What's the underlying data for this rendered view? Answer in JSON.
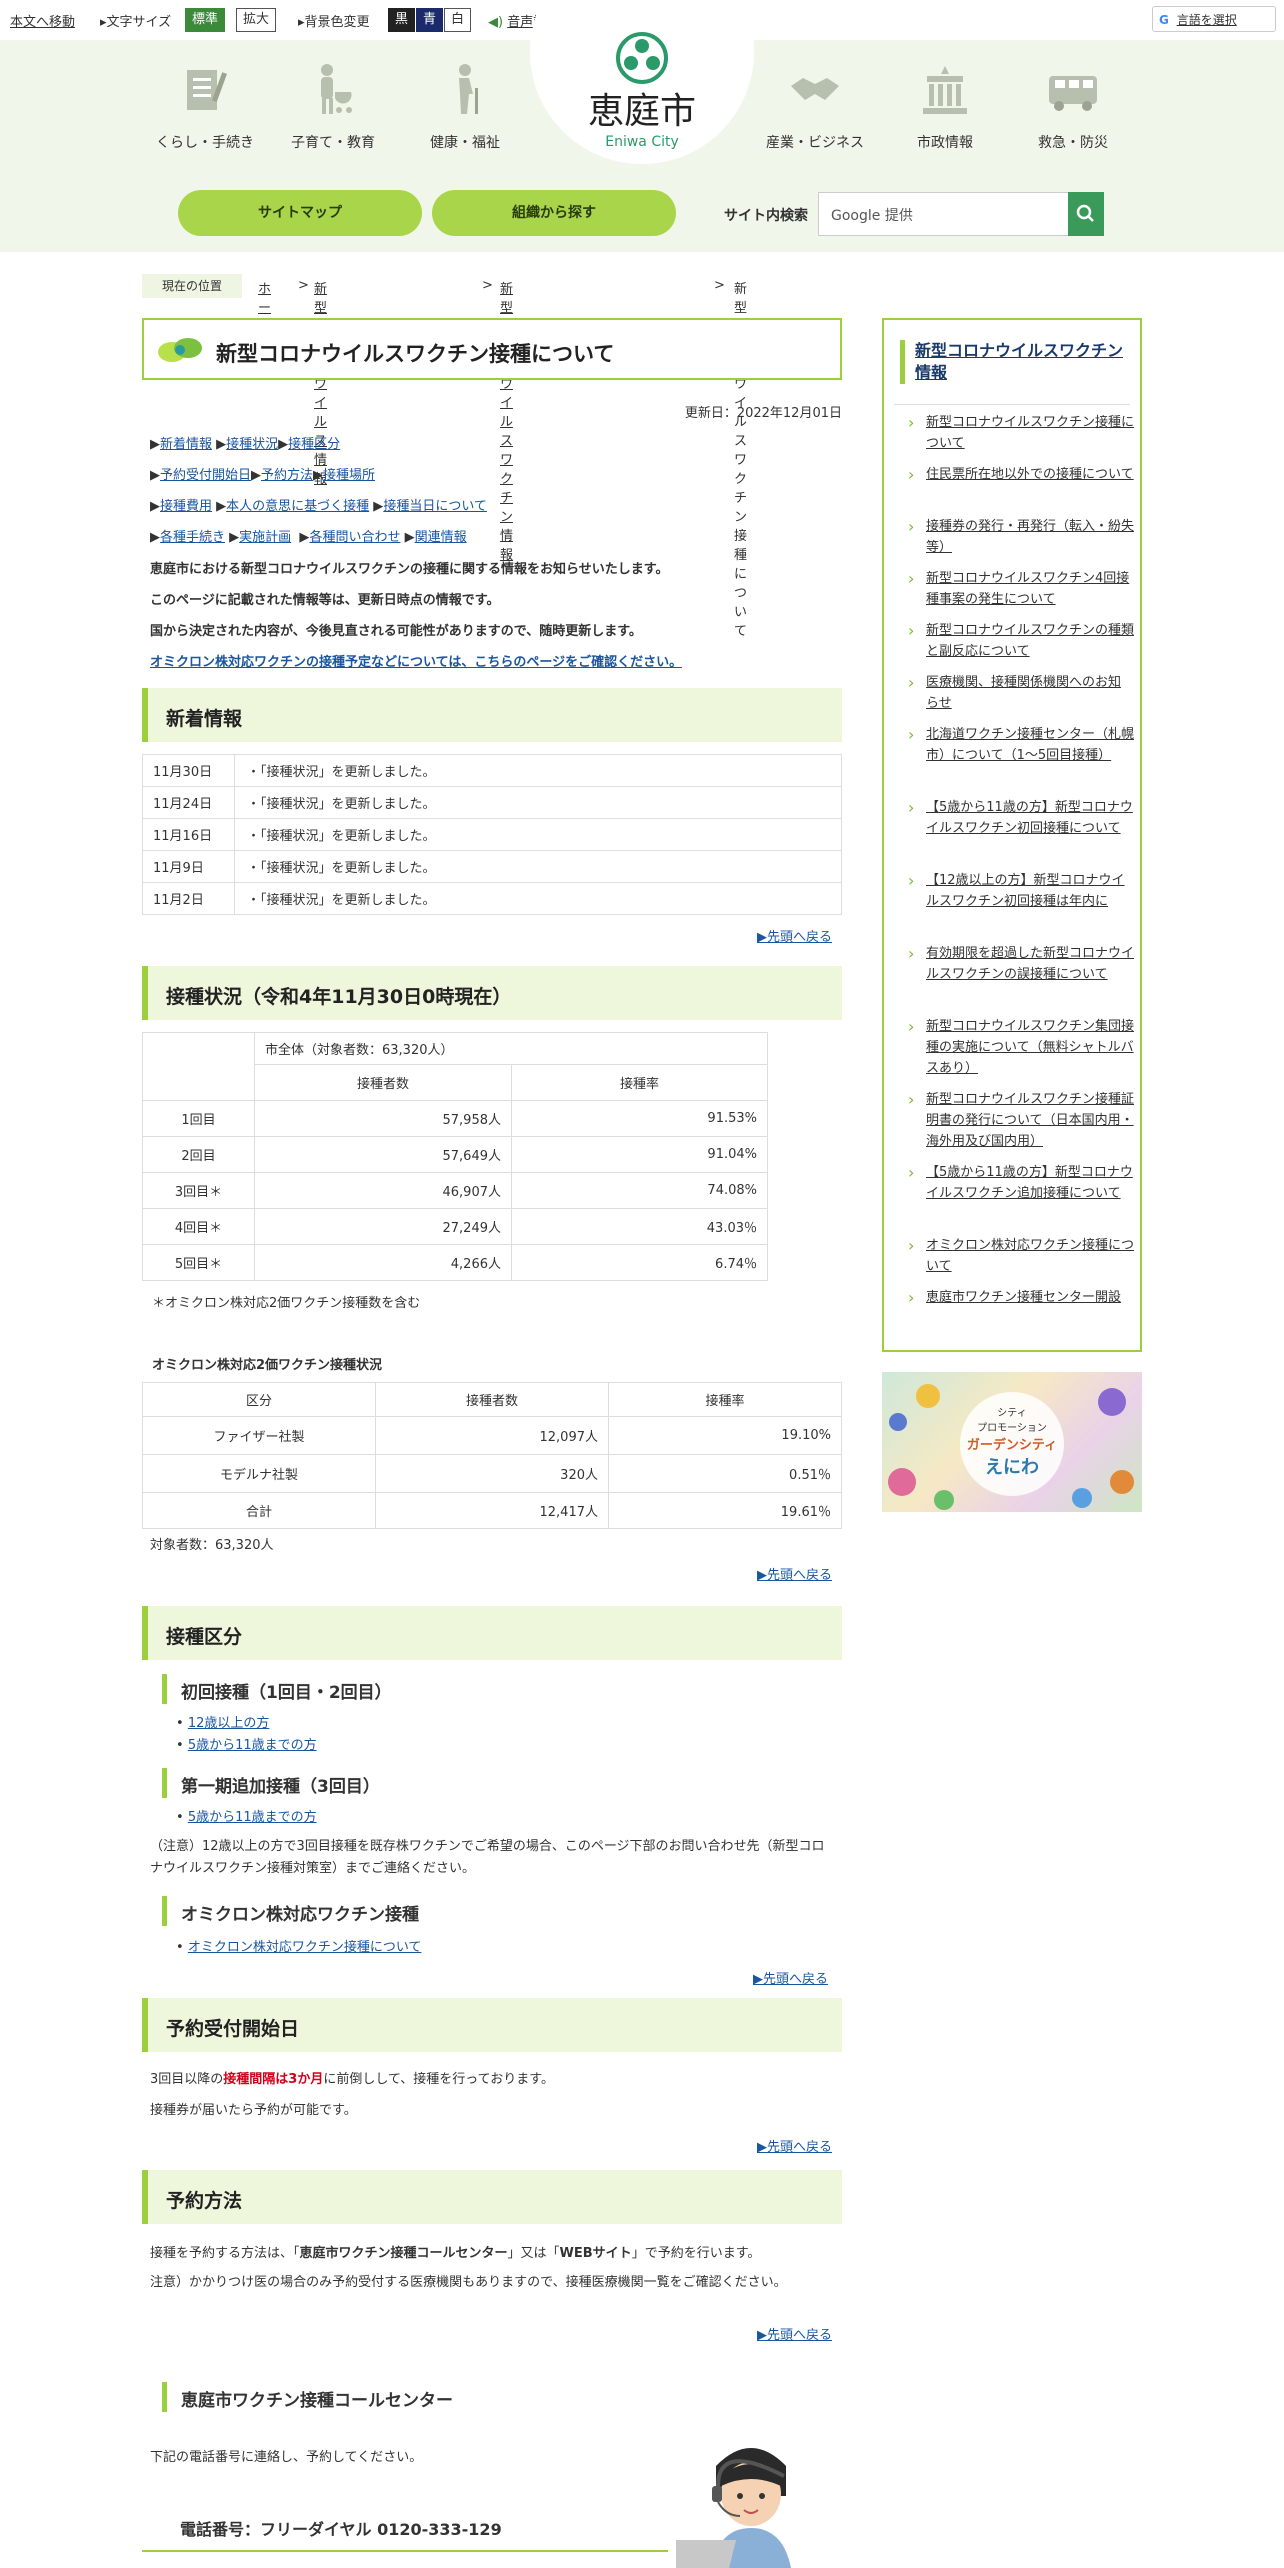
{
  "topbar": {
    "skip": "本文へ移動",
    "fontsize_label": "文字サイズ",
    "fontsize_std": "標準",
    "fontsize_large": "拡大",
    "bg_label": "背景色変更",
    "bg_black": "黒",
    "bg_blue": "青",
    "bg_white": "白",
    "voice": "音声読み上げ",
    "translate": "言語を選択"
  },
  "logo": {
    "name": "恵庭市",
    "en": "Eniwa City"
  },
  "nav": [
    {
      "label": "くらし・手続き"
    },
    {
      "label": "子育て・教育"
    },
    {
      "label": "健康・福祉"
    },
    {
      "label": "産業・ビジネス"
    },
    {
      "label": "市政情報"
    },
    {
      "label": "救急・防災"
    }
  ],
  "header_buttons": {
    "sitemap": "サイトマップ",
    "org": "組織から探す"
  },
  "search": {
    "label": "サイト内検索",
    "placeholder": "Google 提供"
  },
  "breadcrumb": {
    "label": "現在の位置",
    "items": [
      "ホーム",
      "新型コロナウイルス情報",
      "新型コロナウイルスワクチン情報",
      "新型コロナウイルスワクチン接種について"
    ]
  },
  "page": {
    "title": "新型コロナウイルスワクチン接種について",
    "updated": "更新日：2022年12月01日",
    "links_row1": [
      "新着情報",
      "接種状況",
      "接種区分"
    ],
    "links_row2": [
      "予約受付開始日",
      "予約方法",
      "接種場所"
    ],
    "links_row3": [
      "接種費用",
      "本人の意思に基づく接種",
      "接種当日について"
    ],
    "links_row4": [
      "各種手続き",
      "実施計画",
      "各種問い合わせ",
      "関連情報"
    ],
    "intro1": "恵庭市における新型コロナウイルスワクチンの接種に関する情報をお知らせいたします。",
    "intro2": "このページに記載された情報等は、更新日時点の情報です。",
    "intro3": "国から決定された内容が、今後見直される可能性がありますので、随時更新します。",
    "omicron_link": "オミクロン株対応ワクチンの接種予定などについては、こちらのページをご確認ください。"
  },
  "news": {
    "heading": "新着情報",
    "items": [
      {
        "date": "11月30日",
        "text": "・「接種状況」を更新しました。"
      },
      {
        "date": "11月24日",
        "text": "・「接種状況」を更新しました。"
      },
      {
        "date": "11月16日",
        "text": "・「接種状況」を更新しました。"
      },
      {
        "date": "11月9日",
        "text": "・「接種状況」を更新しました。"
      },
      {
        "date": "11月2日",
        "text": "・「接種状況」を更新しました。"
      }
    ]
  },
  "back_to_top": "▶先頭へ戻る",
  "status": {
    "heading": "接種状況（令和4年11月30日0時現在）",
    "group": "市全体（対象者数：63,320人）",
    "col1": "接種者数",
    "col2": "接種率",
    "rows": [
      {
        "dose": "1回目",
        "count": "57,958人",
        "rate": "91.53%"
      },
      {
        "dose": "2回目",
        "count": "57,649人",
        "rate": "91.04%"
      },
      {
        "dose": "3回目＊",
        "count": "46,907人",
        "rate": "74.08%"
      },
      {
        "dose": "4回目＊",
        "count": "27,249人",
        "rate": "43.03％"
      },
      {
        "dose": "5回目＊",
        "count": "4,266人",
        "rate": "6.74％"
      }
    ],
    "note": "＊オミクロン株対応2価ワクチン接種数を含む"
  },
  "omicron": {
    "heading": "オミクロン株対応2価ワクチン接種状況",
    "cols": [
      "区分",
      "接種者数",
      "接種率"
    ],
    "rows": [
      {
        "kind": "ファイザー社製",
        "count": "12,097人",
        "rate": "19.10%"
      },
      {
        "kind": "モデルナ社製",
        "count": "320人",
        "rate": "0.51％"
      },
      {
        "kind": "合計",
        "count": "12,417人",
        "rate": "19.61％"
      }
    ],
    "note": "対象者数：63,320人"
  },
  "category": {
    "heading": "接種区分",
    "sub1": "初回接種（1回目・2回目）",
    "sub1_links": [
      "12歳以上の方",
      "5歳から11歳までの方"
    ],
    "sub2": "第一期追加接種（3回目）",
    "sub2_links": [
      "5歳から11歳までの方"
    ],
    "note": "（注意）12歳以上の方で3回目接種を既存株ワクチンでご希望の場合、このページ下部のお問い合わせ先（新型コロナウイルスワクチン接種対策室）までご連絡ください。",
    "sub3": "オミクロン株対応ワクチン接種",
    "sub3_links": [
      "オミクロン株対応ワクチン接種について"
    ]
  },
  "reservation_start": {
    "heading": "予約受付開始日",
    "text_pre": "3回目以降の",
    "text_em": "接種間隔は3か月",
    "text_post": "に前倒しして、接種を行っております。",
    "text2": "接種券が届いたら予約が可能です。"
  },
  "reservation_method": {
    "heading": "予約方法",
    "text_pre": "接種を予約する方法は、「",
    "text_b1": "恵庭市ワクチン接種コールセンター",
    "text_mid": "」又は「",
    "text_b2": "WEBサイト",
    "text_post": "」で予約を行います。",
    "note": "注意）かかりつけ医の場合のみ予約受付する医療機関もありますので、接種医療機関一覧をご確認ください。"
  },
  "callcenter": {
    "heading": "恵庭市ワクチン接種コールセンター",
    "text": "下記の電話番号に連絡し、予約してください。",
    "phone": "電話番号：フリーダイヤル 0120-333-129"
  },
  "sidebar": {
    "title": "新型コロナウイルスワクチン情報",
    "items": [
      "新型コロナウイルスワクチン接種について",
      "住民票所在地以外での接種について",
      "接種券の発行・再発行（転入・紛失等）",
      "新型コロナウイルスワクチン4回接種事案の発生について",
      "新型コロナウイルスワクチンの種類と副反応について",
      "医療機関、接種関係機関へのお知らせ",
      "北海道ワクチン接種センター（札幌市）について（1～5回目接種）",
      "【5歳から11歳の方】新型コロナウイルスワクチン初回接種について",
      "【12歳以上の方】新型コロナウイルスワクチン初回接種は年内に",
      "有効期限を超過した新型コロナウイルスワクチンの誤接種について",
      "新型コロナウイルスワクチン集団接種の実施について（無料シャトルバスあり）",
      "新型コロナウイルスワクチン接種証明書の発行について（日本国内用・海外用及び国内用）",
      "【5歳から11歳の方】新型コロナウイルスワクチン追加接種について",
      "オミクロン株対応ワクチン接種について",
      "恵庭市ワクチン接種センター開設"
    ]
  },
  "banner": {
    "line1": "シティ",
    "line2": "プロモーション",
    "line3": "ガーデンシティ",
    "line4": "えにわ"
  },
  "colors": {
    "accent": "#9ccf3d",
    "button": "#a8d54a",
    "header_bg": "#f0f7ea",
    "link": "#1a56a0",
    "emphasis": "#d0021b"
  }
}
